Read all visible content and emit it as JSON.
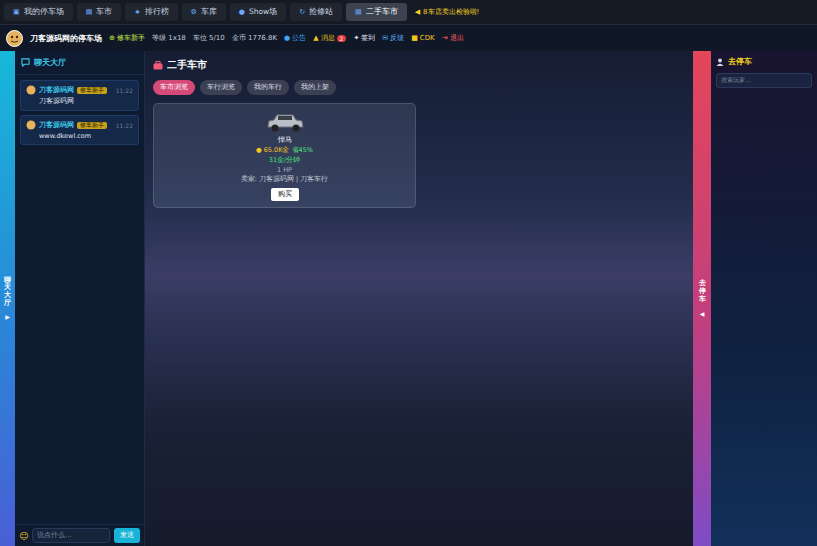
{
  "nav": {
    "tabs": [
      {
        "icon": "▣",
        "label": "我的停车场",
        "selected": false
      },
      {
        "icon": "▤",
        "label": "车市",
        "selected": false
      },
      {
        "icon": "★",
        "label": "排行榜",
        "selected": false
      },
      {
        "icon": "⚙",
        "label": "车库",
        "selected": false
      },
      {
        "icon": "●",
        "label": "Show场",
        "selected": false
      },
      {
        "icon": "↻",
        "label": "抢修站",
        "selected": false
      },
      {
        "icon": "▤",
        "label": "二手车市",
        "selected": true
      }
    ],
    "notice": {
      "icon": "◀",
      "text": "8车店卖出检验啦!"
    }
  },
  "user": {
    "name": "刀客源码网的停车场",
    "title_icon": "⊕",
    "title": "修车新手",
    "stats": [
      "等级 1x18",
      "车位 5/10",
      "金币 1776.8K"
    ],
    "links": [
      {
        "icon": "●",
        "label": "公告",
        "color": "#3fa9f5",
        "badge": ""
      },
      {
        "icon": "▲",
        "label": "消息",
        "color": "#f5c518",
        "badge": "2"
      },
      {
        "icon": "✦",
        "label": "签到",
        "color": "#e0e6f0",
        "badge": ""
      },
      {
        "icon": "✉",
        "label": "反馈",
        "color": "#5fb3ff",
        "badge": ""
      },
      {
        "icon": "■",
        "label": "CDK",
        "color": "#f5c518",
        "badge": ""
      },
      {
        "icon": "⇥",
        "label": "退出",
        "color": "#ff5a5a",
        "badge": ""
      }
    ]
  },
  "chat": {
    "strip_label": "聊天大厅",
    "strip_arrow": "▶",
    "title": "聊天大厅",
    "messages": [
      {
        "user": "刀客源码网",
        "badge": "修车新手",
        "time": "11:22",
        "text": "刀客源码网"
      },
      {
        "user": "刀客源码网",
        "badge": "修车新手",
        "time": "11:22",
        "text": "www.dkewl.com"
      }
    ],
    "emoji": "☺",
    "input_placeholder": "说点什么...",
    "send": "发送"
  },
  "market": {
    "title": "二手车市",
    "tabs": [
      {
        "label": "车市浏览",
        "selected": true
      },
      {
        "label": "车行浏览",
        "selected": false
      },
      {
        "label": "我的车行",
        "selected": false
      },
      {
        "label": "我的上架",
        "selected": false
      }
    ],
    "listings": [
      {
        "name": "悍马",
        "price_icon": "●",
        "price": "65.0K金",
        "discount": "省45%",
        "income": "31金/分钟",
        "hp": "1 HP",
        "seller": "卖家: 刀客源码网 | 刀客车行",
        "button": "购买"
      }
    ]
  },
  "parking": {
    "strip_label": "去停车",
    "strip_arrow": "◀",
    "title": "去停车",
    "search_placeholder": "搜索玩家..."
  }
}
